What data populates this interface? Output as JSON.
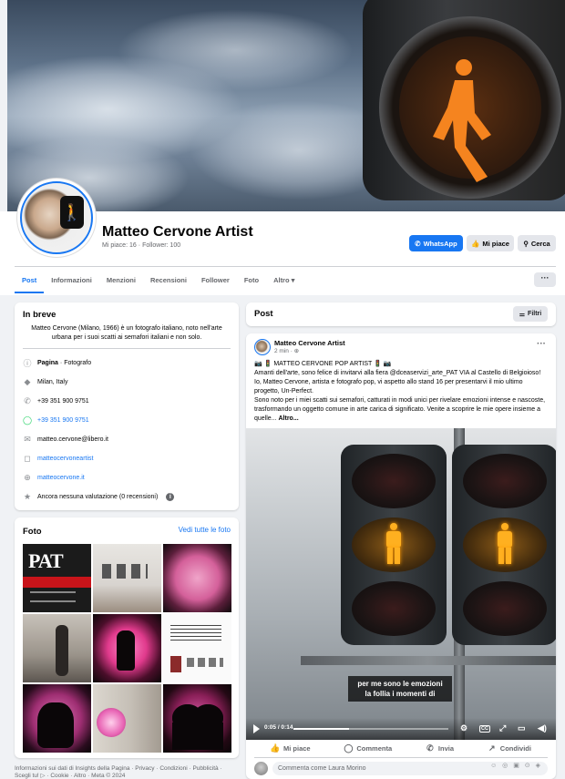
{
  "profile": {
    "name": "Matteo Cervone Artist",
    "likes": "Mi piace: 16",
    "followers": "Follower: 100",
    "buttons": {
      "whatsapp": "WhatsApp",
      "like": "Mi piace",
      "search": "Cerca"
    }
  },
  "tabs": [
    "Post",
    "Informazioni",
    "Menzioni",
    "Recensioni",
    "Follower",
    "Foto",
    "Altro"
  ],
  "more_button": "···",
  "intro": {
    "title": "In breve",
    "bio": "Matteo Cervone (Milano, 1966) è un fotografo italiano, noto nell'arte urbana per i suoi scatti ai semafori italiani e non solo.",
    "page_label": "Pagina",
    "page_category": "Fotografo",
    "location": "Milan, Italy",
    "phone": "+39 351 900 9751",
    "whatsapp": "+39 351 900 9751",
    "email": "matteo.cervone@libero.it",
    "instagram": "matteocervoneartist",
    "website": "matteocervone.it",
    "rating": "Ancora nessuna valutazione (0 recensioni)"
  },
  "photos": {
    "title": "Foto",
    "see_all": "Vedi tutte le foto",
    "pat_text": "PAT"
  },
  "footer": "Informazioni sui dati di Insights della Pagina · Privacy · Condizioni · Pubblicità · Scegli tu! ▷ · Cookie · Altro · Meta © 2024",
  "posts_header": {
    "title": "Post",
    "filter": "Filtri"
  },
  "post": {
    "author": "Matteo Cervone Artist",
    "time": "2 min · ⊕",
    "line1": "📷 🚦 MATTEO CERVONE POP ARTIST 🚦 📷",
    "body": "Amanti dell'arte, sono felice di invitarvi alla fiera @dceaservizi_arte_PAT VIA al Castello di Belgioioso! Io, Matteo Cervone, artista e fotografo pop, vi aspetto allo stand 16 per presentarvi il mio ultimo progetto, Un-Perfect.",
    "body2": "Sono noto per i miei scatti sui semafori, catturati in modi unici per rivelare emozioni intense e nascoste, trasformando un oggetto comune in arte carica di significato. Venite a scoprire le mie opere insieme a quelle...",
    "more": "Altro...",
    "subtitle": "per me sono le emozioni la follia i momenti di",
    "video_time": "0:05 / 0:14",
    "video_progress": 0.36,
    "actions": {
      "like": "Mi piace",
      "comment": "Commenta",
      "share_wa": "Invia",
      "share": "Condividi"
    },
    "comment_placeholder": "Commenta come Laura Morino"
  },
  "colors": {
    "accent": "#1877f2",
    "background": "#f0f2f5",
    "walker_light": "#ffb020"
  }
}
